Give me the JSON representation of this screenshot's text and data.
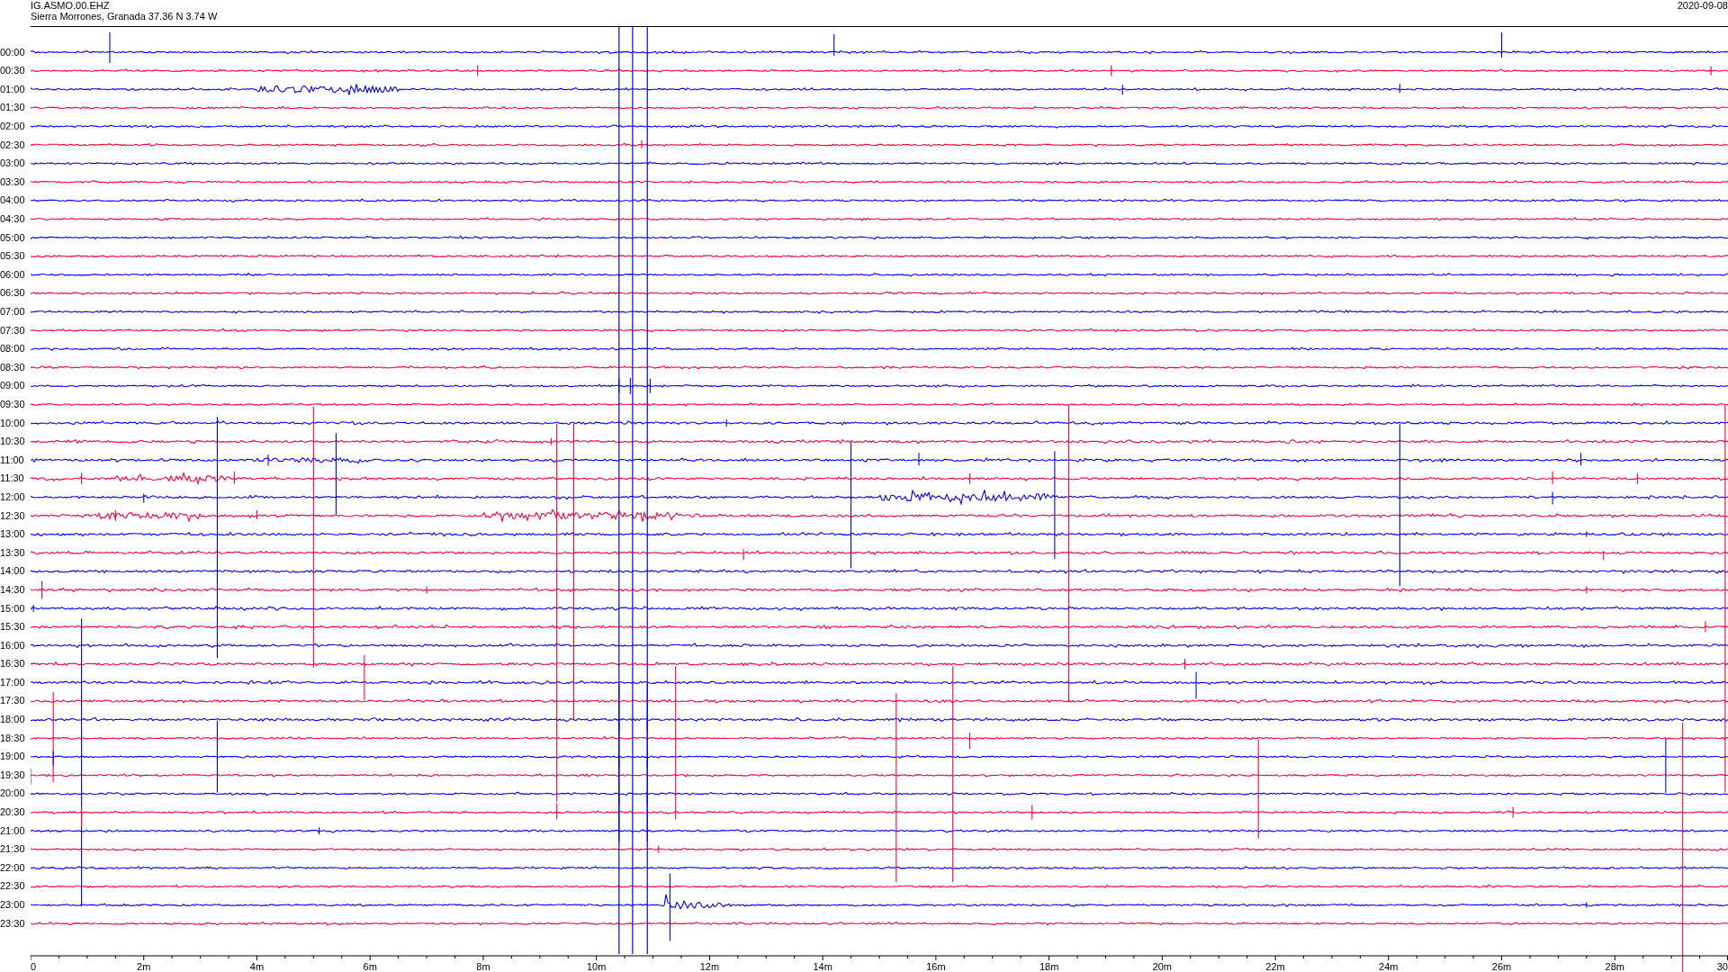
{
  "header": {
    "station": "IG.ASMO.00.EHZ",
    "location": "Sierra Morrones, Granada  37.36 N 3.74 W",
    "date": "2020-09-08"
  },
  "rows": [
    {
      "label": "00:00",
      "color": "#0000ff"
    },
    {
      "label": "00:30",
      "color": "#ff0033"
    },
    {
      "label": "01:00",
      "color": "#0000ff"
    },
    {
      "label": "01:30",
      "color": "#ff0033"
    },
    {
      "label": "02:00",
      "color": "#0000ff"
    },
    {
      "label": "02:30",
      "color": "#ff0033"
    },
    {
      "label": "03:00",
      "color": "#0000ff"
    },
    {
      "label": "03:30",
      "color": "#ff0033"
    },
    {
      "label": "04:00",
      "color": "#0000ff"
    },
    {
      "label": "04:30",
      "color": "#ff0033"
    },
    {
      "label": "05:00",
      "color": "#0000ff"
    },
    {
      "label": "05:30",
      "color": "#ff0033"
    },
    {
      "label": "06:00",
      "color": "#0000ff"
    },
    {
      "label": "06:30",
      "color": "#ff0033"
    },
    {
      "label": "07:00",
      "color": "#0000ff"
    },
    {
      "label": "07:30",
      "color": "#ff0033"
    },
    {
      "label": "08:00",
      "color": "#0000ff"
    },
    {
      "label": "08:30",
      "color": "#ff0033"
    },
    {
      "label": "09:00",
      "color": "#0000ff"
    },
    {
      "label": "09:30",
      "color": "#ff0033"
    },
    {
      "label": "10:00",
      "color": "#0000ff"
    },
    {
      "label": "10:30",
      "color": "#ff0033"
    },
    {
      "label": "11:00",
      "color": "#0000ff"
    },
    {
      "label": "11:30",
      "color": "#ff0033"
    },
    {
      "label": "12:00",
      "color": "#0000ff"
    },
    {
      "label": "12:30",
      "color": "#ff0033"
    },
    {
      "label": "13:00",
      "color": "#0000ff"
    },
    {
      "label": "13:30",
      "color": "#ff0033"
    },
    {
      "label": "14:00",
      "color": "#0000ff"
    },
    {
      "label": "14:30",
      "color": "#ff0033"
    },
    {
      "label": "15:00",
      "color": "#0000ff"
    },
    {
      "label": "15:30",
      "color": "#ff0033"
    },
    {
      "label": "16:00",
      "color": "#0000ff"
    },
    {
      "label": "16:30",
      "color": "#ff0033"
    },
    {
      "label": "17:00",
      "color": "#0000ff"
    },
    {
      "label": "17:30",
      "color": "#ff0033"
    },
    {
      "label": "18:00",
      "color": "#0000ff"
    },
    {
      "label": "18:30",
      "color": "#ff0033"
    },
    {
      "label": "19:00",
      "color": "#0000ff"
    },
    {
      "label": "19:30",
      "color": "#ff0033"
    },
    {
      "label": "20:00",
      "color": "#0000ff"
    },
    {
      "label": "20:30",
      "color": "#ff0033"
    },
    {
      "label": "21:00",
      "color": "#0000ff"
    },
    {
      "label": "21:30",
      "color": "#ff0033"
    },
    {
      "label": "22:00",
      "color": "#0000ff"
    },
    {
      "label": "22:30",
      "color": "#ff0033"
    },
    {
      "label": "23:00",
      "color": "#0000ff"
    },
    {
      "label": "23:30",
      "color": "#ff0033"
    }
  ],
  "x_axis": {
    "ticks": [
      "0",
      "2m",
      "4m",
      "6m",
      "8m",
      "10m",
      "12m",
      "14m",
      "16m",
      "18m",
      "20m",
      "22m",
      "24m",
      "26m",
      "28m",
      "30"
    ]
  }
}
